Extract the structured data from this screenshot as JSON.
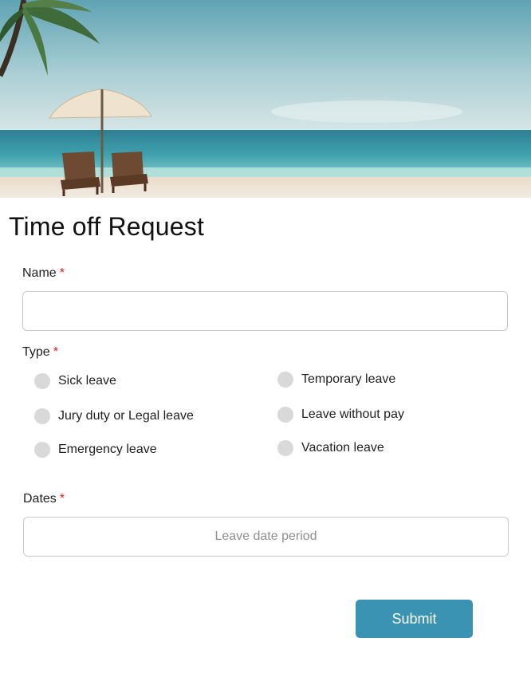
{
  "form": {
    "title": "Time off Request",
    "required_mark": "*",
    "name": {
      "label": "Name",
      "value": "",
      "placeholder": ""
    },
    "type": {
      "label": "Type",
      "options": [
        "Sick leave",
        "Temporary leave",
        "Jury duty or Legal leave",
        "Leave without pay",
        "Emergency leave",
        "Vacation leave"
      ],
      "selected": null
    },
    "dates": {
      "label": "Dates",
      "value": "",
      "placeholder": "Leave date period"
    },
    "submit_label": "Submit"
  },
  "colors": {
    "accent": "#3a93b3",
    "required": "#e02020",
    "radio_unselected": "#d9d9d9",
    "input_border": "#c9c9c9"
  },
  "icons": {
    "hero": "beach-banner-image"
  }
}
